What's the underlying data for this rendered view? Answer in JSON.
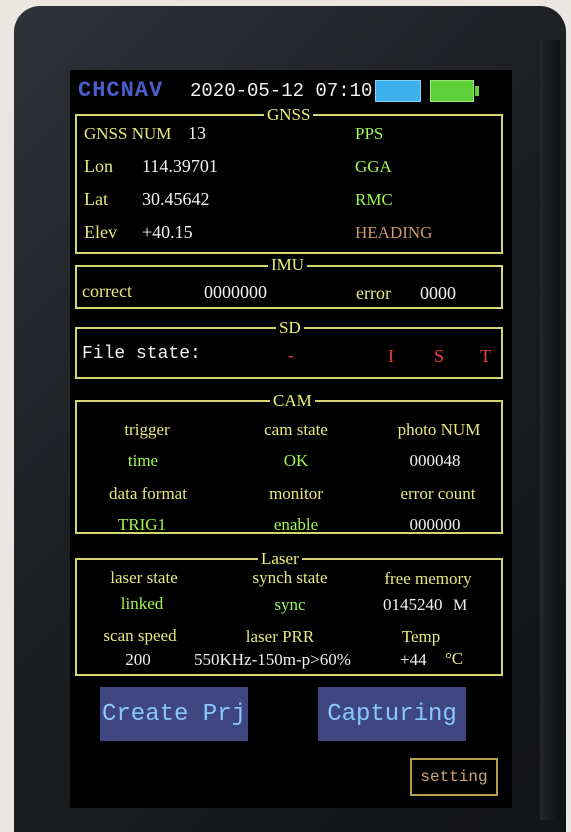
{
  "header": {
    "logo_text": "CHCNAV",
    "datetime": "2020-05-12 07:10",
    "battery_colors": [
      "#3fb0ee",
      "#5ed13a"
    ]
  },
  "gnss": {
    "title": "GNSS",
    "rows": [
      {
        "label": "GNSS NUM",
        "value": "13",
        "status": "PPS"
      },
      {
        "label": "Lon",
        "value": "114.39701",
        "status": "GGA"
      },
      {
        "label": "Lat",
        "value": "30.45642",
        "status": "RMC"
      },
      {
        "label": "Elev",
        "value": "+40.15",
        "status": "HEADING"
      }
    ]
  },
  "imu": {
    "title": "IMU",
    "correct_label": "correct",
    "correct_value": "0000000",
    "error_label": "error",
    "error_value": "0000"
  },
  "sd": {
    "title": "SD",
    "file_state_label": "File state:",
    "file_state_value": "-",
    "flags": [
      "I",
      "S",
      "T"
    ]
  },
  "cam": {
    "title": "CAM",
    "headers_1": [
      "trigger",
      "cam state",
      "photo NUM"
    ],
    "values_1": [
      "time",
      "OK",
      "000048"
    ],
    "headers_2": [
      "data format",
      "monitor",
      "error count"
    ],
    "values_2": [
      "TRIG1",
      "enable",
      "000000"
    ]
  },
  "laser": {
    "title": "Laser",
    "headers_1": [
      "laser state",
      "synch state",
      "free memory"
    ],
    "values_1": [
      "linked",
      "sync",
      "0145240"
    ],
    "memory_unit": "M",
    "headers_2": [
      "scan speed",
      "laser PRR",
      "Temp"
    ],
    "scan_speed": "200",
    "laser_prr": "550KHz-150m-p>60%",
    "temp": "+44",
    "temp_unit": "°C"
  },
  "buttons": {
    "create": "Create Prj",
    "capture": "Capturing",
    "setting": "setting"
  },
  "colors": {
    "frame": "#d5d56e",
    "label": "#e6e880",
    "value_white": "#f1f2f0",
    "value_green": "#9ff74f",
    "status_red": "#ec3c42",
    "button_bg": "#3f4681",
    "button_text": "#88c8ff"
  }
}
